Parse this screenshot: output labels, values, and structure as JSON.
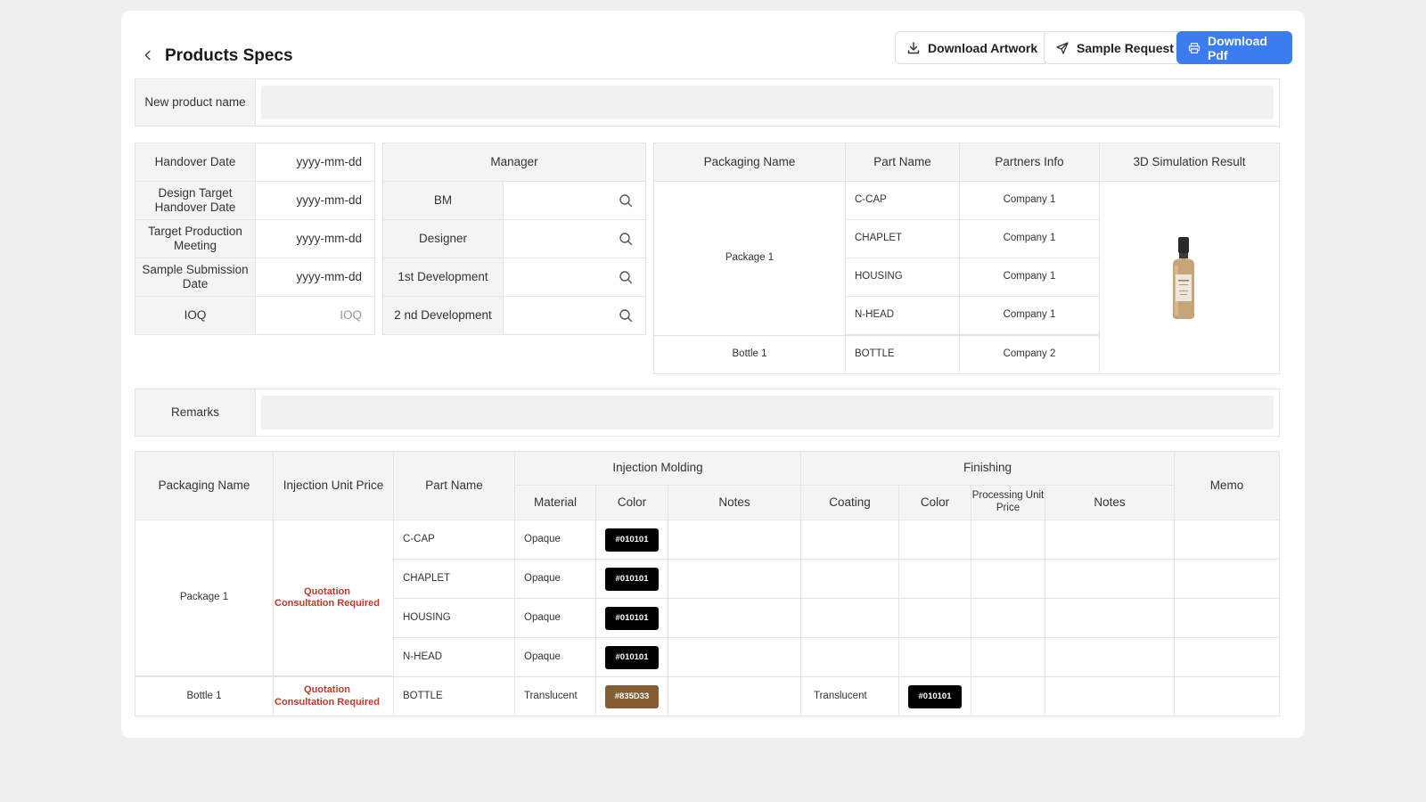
{
  "header": {
    "title": "Products Specs",
    "buttons": {
      "download_artwork": "Download Artwork",
      "sample_request": "Sample Request",
      "download_pdf": "Download Pdf"
    }
  },
  "product_name": {
    "label": "New product name",
    "value": ""
  },
  "dates": [
    {
      "label": "Handover Date",
      "value": "yyyy-mm-dd"
    },
    {
      "label": "Design Target Handover Date",
      "value": "yyyy-mm-dd"
    },
    {
      "label": "Target Production Meeting",
      "value": "yyyy-mm-dd"
    },
    {
      "label": "Sample Submission Date",
      "value": "yyyy-mm-dd"
    },
    {
      "label": "IOQ",
      "placeholder": "IOQ"
    }
  ],
  "manager": {
    "header": "Manager",
    "rows": [
      {
        "label": "BM",
        "value": ""
      },
      {
        "label": "Designer",
        "value": ""
      },
      {
        "label": "1st Development",
        "value": ""
      },
      {
        "label": "2 nd Development",
        "value": ""
      }
    ]
  },
  "packaging": {
    "headers": [
      "Packaging Name",
      "Part Name",
      "Partners Info",
      "3D Simulation Result"
    ],
    "groups": [
      {
        "name": "Package 1",
        "parts": [
          {
            "part": "C-CAP",
            "partner": "Company 1"
          },
          {
            "part": "CHAPLET",
            "partner": "Company 1"
          },
          {
            "part": "HOUSING",
            "partner": "Company 1"
          },
          {
            "part": "N-HEAD",
            "partner": "Company 1"
          }
        ]
      },
      {
        "name": "Bottle 1",
        "parts": [
          {
            "part": "BOTTLE",
            "partner": "Company 2"
          }
        ]
      }
    ]
  },
  "remarks": {
    "label": "Remarks",
    "value": ""
  },
  "spec_table": {
    "headers": {
      "packaging_name": "Packaging Name",
      "injection_unit_price": "Injection Unit Price",
      "part_name": "Part Name",
      "injection_molding": "Injection Molding",
      "finishing": "Finishing",
      "memo": "Memo",
      "material": "Material",
      "color": "Color",
      "notes": "Notes",
      "coating": "Coating",
      "finishing_color": "Color",
      "processing_unit_price": "Processing Unit Price",
      "finishing_notes": "Notes"
    },
    "groups": [
      {
        "name": "Package 1",
        "price": "Quotation Consultation Required",
        "rows": [
          {
            "part": "C-CAP",
            "material": "Opaque",
            "color": "#010101"
          },
          {
            "part": "CHAPLET",
            "material": "Opaque",
            "color": "#010101"
          },
          {
            "part": "HOUSING",
            "material": "Opaque",
            "color": "#010101"
          },
          {
            "part": "N-HEAD",
            "material": "Opaque",
            "color": "#010101"
          }
        ]
      },
      {
        "name": "Bottle 1",
        "price": "Quotation Consultation Required",
        "rows": [
          {
            "part": "BOTTLE",
            "material": "Translucent",
            "color": "#835D33",
            "coating": "Translucent",
            "finishing_color": "#010101"
          }
        ]
      }
    ]
  },
  "colors": {
    "accent": "#3b7cf0",
    "warning_text": "#c0392b",
    "swatch_black": "#010101",
    "swatch_brown": "#835D33"
  }
}
